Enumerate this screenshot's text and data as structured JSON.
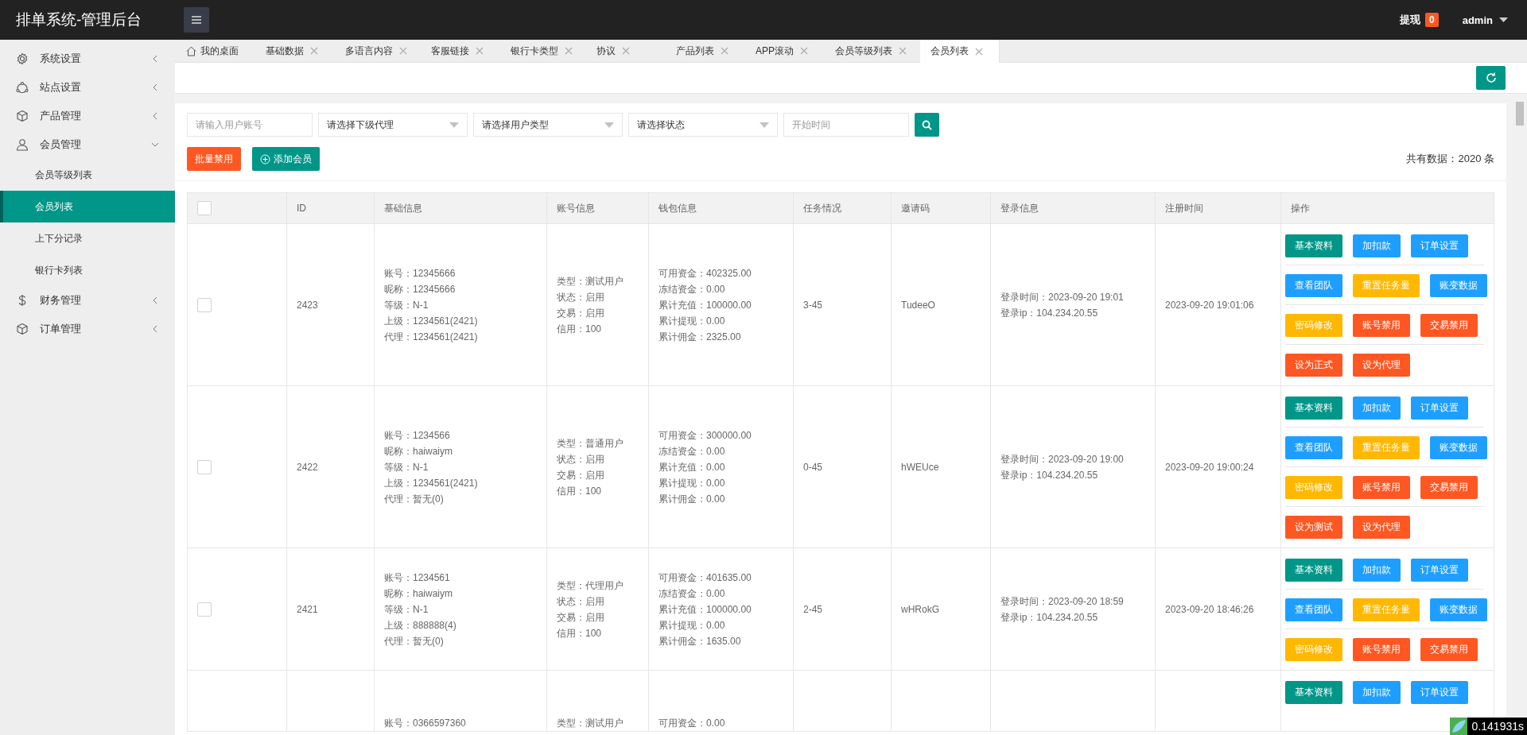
{
  "header": {
    "title": "排单系统-管理后台",
    "withdraw_label": "提现",
    "withdraw_count": "0",
    "user": "admin"
  },
  "sidebar": {
    "items": [
      {
        "label": "系统设置",
        "expanded": false
      },
      {
        "label": "站点设置",
        "expanded": false
      },
      {
        "label": "产品管理",
        "expanded": false
      },
      {
        "label": "会员管理",
        "expanded": true,
        "children": [
          {
            "label": "会员等级列表",
            "selected": false
          },
          {
            "label": "会员列表",
            "selected": true
          },
          {
            "label": "上下分记录",
            "selected": false
          },
          {
            "label": "银行卡列表",
            "selected": false
          }
        ]
      },
      {
        "label": "财务管理",
        "expanded": false
      },
      {
        "label": "订单管理",
        "expanded": false
      }
    ]
  },
  "tabs": [
    {
      "label": "我的桌面",
      "selected": false,
      "closable": false
    },
    {
      "label": "基础数据",
      "selected": false,
      "closable": true
    },
    {
      "label": "多语言内容",
      "selected": false,
      "closable": true
    },
    {
      "label": "客服链接",
      "selected": false,
      "closable": true
    },
    {
      "label": "银行卡类型",
      "selected": false,
      "closable": true
    },
    {
      "label": "协议",
      "selected": false,
      "closable": true
    },
    {
      "label": "产品列表",
      "selected": false,
      "closable": true
    },
    {
      "label": "APP滚动",
      "selected": false,
      "closable": true
    },
    {
      "label": "会员等级列表",
      "selected": false,
      "closable": true
    },
    {
      "label": "会员列表",
      "selected": true,
      "closable": true
    }
  ],
  "filters": {
    "account_placeholder": "请输入用户账号",
    "selects": [
      "请选择下级代理",
      "请选择用户类型",
      "请选择状态"
    ],
    "date_placeholder": "开始时间"
  },
  "actions": {
    "batch_disable": "批量禁用",
    "add_member": "添加会员",
    "total": "共有数据：2020 条"
  },
  "table": {
    "all_checked": false,
    "columns": [
      "ID",
      "基础信息",
      "账号信息",
      "钱包信息",
      "任务情况",
      "邀请码",
      "登录信息",
      "注册时间",
      "操作"
    ],
    "rows": [
      {
        "checked": false,
        "id": "2423",
        "basic": [
          "账号：12345666",
          "昵称：12345666",
          "等级：N-1",
          "上级：1234561(2421)",
          "代理：1234561(2421)"
        ],
        "account": [
          "类型：测试用户",
          "状态：启用",
          "交易：启用",
          "信用：100"
        ],
        "wallet": [
          "可用资金：402325.00",
          "冻结资金：0.00",
          "累计充值：100000.00",
          "累计提现：0.00",
          "累计佣金：2325.00"
        ],
        "task": "3-45",
        "invite": "TudeeO",
        "login": [
          "登录时间：2023-09-20 19:01",
          "登录ip：104.234.20.55"
        ],
        "registered": "2023-09-20 19:01:06",
        "buttons": [
          [
            {
              "label": "基本资料",
              "color": "#009688"
            },
            {
              "label": "加扣款",
              "color": "#1e9fff"
            },
            {
              "label": "订单设置",
              "color": "#1e9fff"
            }
          ],
          [
            {
              "label": "查看团队",
              "color": "#1e9fff"
            },
            {
              "label": "重置任务量",
              "color": "#ffb800"
            },
            {
              "label": "账变数据",
              "color": "#1e9fff"
            }
          ],
          [
            {
              "label": "密码修改",
              "color": "#ffb800"
            },
            {
              "label": "账号禁用",
              "color": "#ff5722"
            },
            {
              "label": "交易禁用",
              "color": "#ff5722"
            }
          ],
          [
            {
              "label": "设为正式",
              "color": "#ff5722"
            },
            {
              "label": "设为代理",
              "color": "#ff5722"
            }
          ]
        ]
      },
      {
        "checked": false,
        "id": "2422",
        "basic": [
          "账号：1234566",
          "昵称：haiwaiym",
          "等级：N-1",
          "上级：1234561(2421)",
          "代理：暂无(0)"
        ],
        "account": [
          "类型：普通用户",
          "状态：启用",
          "交易：启用",
          "信用：100"
        ],
        "wallet": [
          "可用资金：300000.00",
          "冻结资金：0.00",
          "累计充值：0.00",
          "累计提现：0.00",
          "累计佣金：0.00"
        ],
        "task": "0-45",
        "invite": "hWEUce",
        "login": [
          "登录时间：2023-09-20 19:00",
          "登录ip：104.234.20.55"
        ],
        "registered": "2023-09-20 19:00:24",
        "buttons": [
          [
            {
              "label": "基本资料",
              "color": "#009688"
            },
            {
              "label": "加扣款",
              "color": "#1e9fff"
            },
            {
              "label": "订单设置",
              "color": "#1e9fff"
            }
          ],
          [
            {
              "label": "查看团队",
              "color": "#1e9fff"
            },
            {
              "label": "重置任务量",
              "color": "#ffb800"
            },
            {
              "label": "账变数据",
              "color": "#1e9fff"
            }
          ],
          [
            {
              "label": "密码修改",
              "color": "#ffb800"
            },
            {
              "label": "账号禁用",
              "color": "#ff5722"
            },
            {
              "label": "交易禁用",
              "color": "#ff5722"
            }
          ],
          [
            {
              "label": "设为测试",
              "color": "#ff5722"
            },
            {
              "label": "设为代理",
              "color": "#ff5722"
            }
          ]
        ]
      },
      {
        "checked": false,
        "id": "2421",
        "basic": [
          "账号：1234561",
          "昵称：haiwaiym",
          "等级：N-1",
          "上级：888888(4)",
          "代理：暂无(0)"
        ],
        "account": [
          "类型：代理用户",
          "状态：启用",
          "交易：启用",
          "信用：100"
        ],
        "wallet": [
          "可用资金：401635.00",
          "冻结资金：0.00",
          "累计充值：100000.00",
          "累计提现：0.00",
          "累计佣金：1635.00"
        ],
        "task": "2-45",
        "invite": "wHRokG",
        "login": [
          "登录时间：2023-09-20 18:59",
          "登录ip：104.234.20.55"
        ],
        "registered": "2023-09-20 18:46:26",
        "buttons": [
          [
            {
              "label": "基本资料",
              "color": "#009688"
            },
            {
              "label": "加扣款",
              "color": "#1e9fff"
            },
            {
              "label": "订单设置",
              "color": "#1e9fff"
            }
          ],
          [
            {
              "label": "查看团队",
              "color": "#1e9fff"
            },
            {
              "label": "重置任务量",
              "color": "#ffb800"
            },
            {
              "label": "账变数据",
              "color": "#1e9fff"
            }
          ],
          [
            {
              "label": "密码修改",
              "color": "#ffb800"
            },
            {
              "label": "账号禁用",
              "color": "#ff5722"
            },
            {
              "label": "交易禁用",
              "color": "#ff5722"
            }
          ]
        ]
      },
      {
        "basic": [
          "账号：0366597360"
        ],
        "account": [
          "类型：测试用户"
        ],
        "wallet": [
          "可用资金：0.00"
        ],
        "buttons": [
          [
            {
              "label": "基本资料",
              "color": "#009688"
            },
            {
              "label": "加扣款",
              "color": "#1e9fff"
            },
            {
              "label": "订单设置",
              "color": "#1e9fff"
            }
          ]
        ]
      }
    ]
  },
  "debug": {
    "time": "0.141931s"
  }
}
